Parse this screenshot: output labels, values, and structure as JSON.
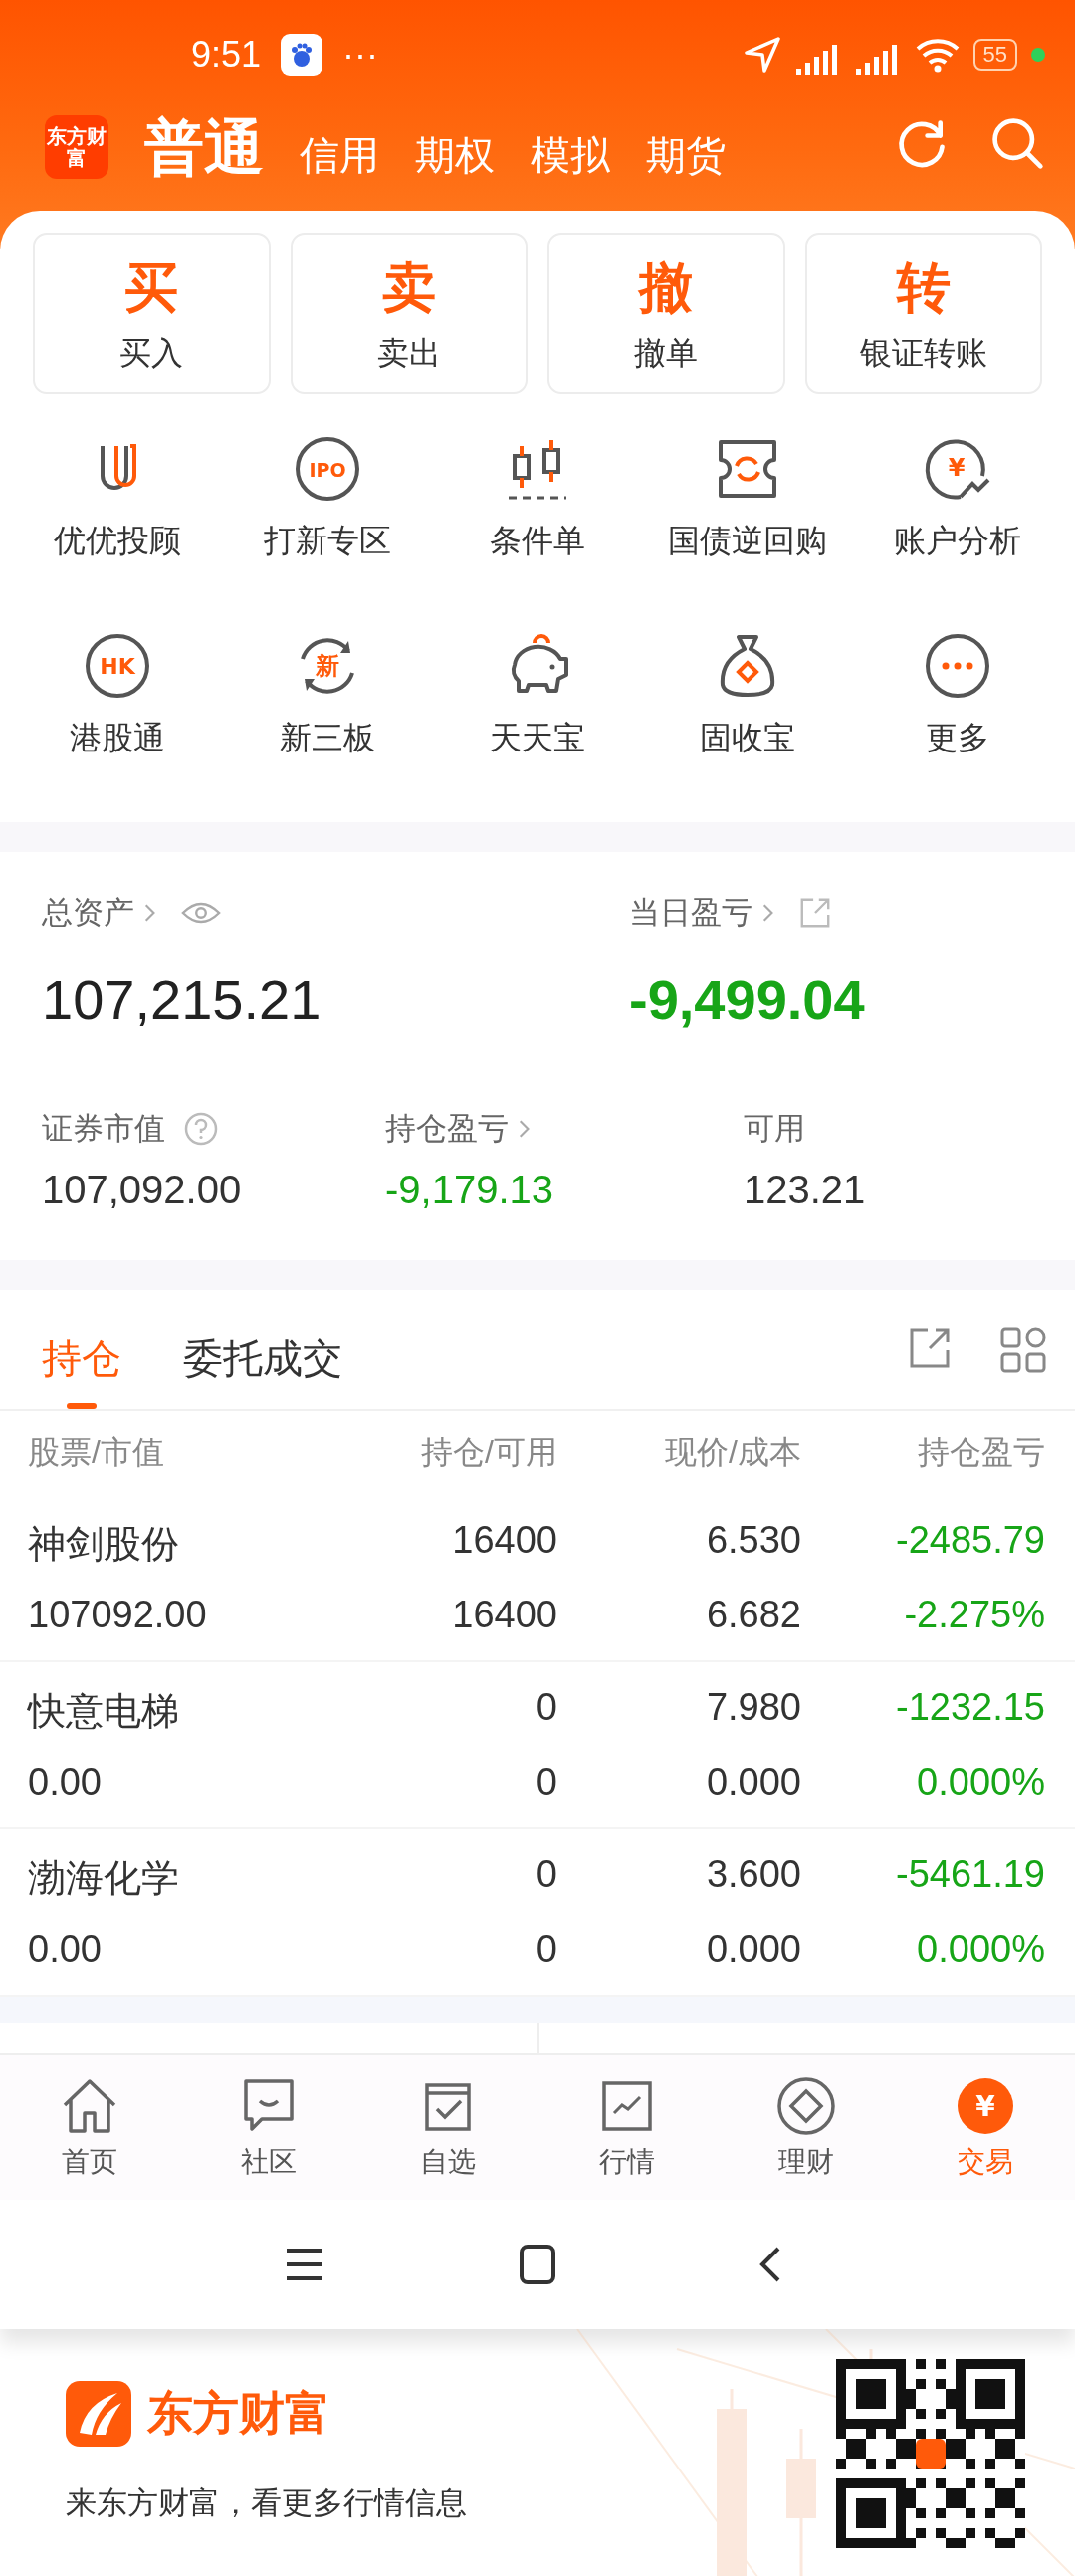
{
  "status_bar": {
    "time": "9:51",
    "more": "···",
    "battery": "55"
  },
  "header": {
    "logo_text": "东方财富",
    "tabs": [
      {
        "label": "普通",
        "selected": true
      },
      {
        "label": "信用",
        "selected": false
      },
      {
        "label": "期权",
        "selected": false
      },
      {
        "label": "模拟",
        "selected": false
      },
      {
        "label": "期货",
        "selected": false
      }
    ]
  },
  "quick_actions": [
    {
      "glyph": "买",
      "label": "买入"
    },
    {
      "glyph": "卖",
      "label": "卖出"
    },
    {
      "glyph": "撤",
      "label": "撤单"
    },
    {
      "glyph": "转",
      "label": "银证转账"
    }
  ],
  "services": [
    {
      "kind": "uu",
      "label": "优优投顾"
    },
    {
      "kind": "badge",
      "badge": "IPO",
      "label": "打新专区"
    },
    {
      "kind": "candles",
      "label": "条件单"
    },
    {
      "kind": "ticket",
      "label": "国债逆回购"
    },
    {
      "kind": "yen",
      "badge": "¥",
      "label": "账户分析"
    },
    {
      "kind": "badge",
      "badge": "HK",
      "label": "港股通"
    },
    {
      "kind": "cycle",
      "badge": "新",
      "label": "新三板"
    },
    {
      "kind": "pig",
      "label": "天天宝"
    },
    {
      "kind": "bag",
      "label": "固收宝"
    },
    {
      "kind": "more",
      "label": "更多"
    }
  ],
  "assets": {
    "total_label": "总资产",
    "total_value": "107,215.21",
    "daily_label": "当日盈亏",
    "daily_value": "-9,499.04",
    "daily_loss": true,
    "stats": [
      {
        "kind": "help",
        "label": "证券市值",
        "value": "107,092.00",
        "loss": false
      },
      {
        "kind": "link",
        "label": "持仓盈亏",
        "value": "-9,179.13",
        "loss": true
      },
      {
        "kind": "plain",
        "label": "可用",
        "value": "123.21",
        "loss": false
      }
    ]
  },
  "position_tabs": [
    {
      "label": "持仓",
      "selected": true
    },
    {
      "label": "委托成交",
      "selected": false
    }
  ],
  "table": {
    "columns": [
      "股票/市值",
      "持仓/可用",
      "现价/成本",
      "持仓盈亏"
    ],
    "rows": [
      {
        "name": "神剑股份",
        "market_value": "107092.00",
        "holding": "16400",
        "available": "16400",
        "price": "6.530",
        "cost": "6.682",
        "pnl": "-2485.79",
        "pnl_pct": "-2.275%",
        "loss": true
      },
      {
        "name": "快意电梯",
        "market_value": "0.00",
        "holding": "0",
        "available": "0",
        "price": "7.980",
        "cost": "0.000",
        "pnl": "-1232.15",
        "pnl_pct": "0.000%",
        "loss": true
      },
      {
        "name": "渤海化学",
        "market_value": "0.00",
        "holding": "0",
        "available": "0",
        "price": "3.600",
        "cost": "0.000",
        "pnl": "-5461.19",
        "pnl_pct": "0.000%",
        "loss": true
      }
    ]
  },
  "bottom_nav": [
    {
      "kind": "home",
      "label": "首页",
      "selected": false
    },
    {
      "kind": "chat",
      "label": "社区",
      "selected": false
    },
    {
      "kind": "check",
      "label": "自选",
      "selected": false
    },
    {
      "kind": "chart",
      "label": "行情",
      "selected": false
    },
    {
      "kind": "diamond",
      "label": "理财",
      "selected": false
    },
    {
      "kind": "yen",
      "badge": "¥",
      "label": "交易",
      "selected": true
    }
  ],
  "footer": {
    "brand": "东方财富",
    "slogan": "来东方财富，看更多行情信息"
  }
}
